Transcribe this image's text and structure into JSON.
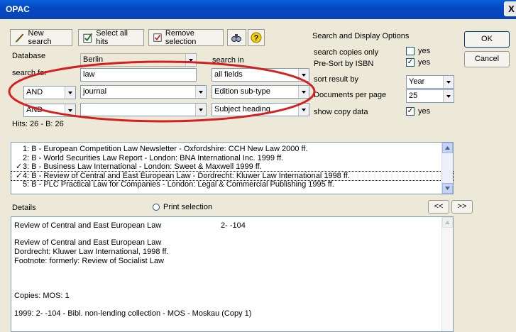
{
  "window": {
    "title": "OPAC",
    "close_glyph": "X"
  },
  "toolbar": {
    "new_search": "New search",
    "select_all": "Select all hits",
    "remove_selection": "Remove selection"
  },
  "search": {
    "database_label": "Database",
    "database_value": "Berlin",
    "search_in_label": "search in",
    "search_for_label": "search for",
    "row1": {
      "term": "law",
      "field": "all fields"
    },
    "row2": {
      "operator": "AND",
      "term": "journal",
      "field": "Edition sub-type"
    },
    "row3": {
      "operator": "AND",
      "term": "",
      "field": "Subject heading"
    },
    "hits": "Hits: 26 - B: 26"
  },
  "options": {
    "heading": "Search and Display Options",
    "copies_only_label": "search copies only",
    "copies_only_checked": false,
    "presort_label": "Pre-Sort by ISBN",
    "presort_checked": true,
    "sort_label": "sort result by",
    "sort_value": "Year",
    "docs_label": "Documents per page",
    "docs_value": "25",
    "copy_data_label": "show copy data",
    "copy_data_checked": true,
    "yes": "yes",
    "check_glyph": "✓"
  },
  "buttons": {
    "ok": "OK",
    "cancel": "Cancel",
    "prev": "<<",
    "next": ">>"
  },
  "results": [
    {
      "text": "1: B - European Competition Law Newsletter - Oxfordshire: CCH New Law 2000 ff.",
      "checked": false
    },
    {
      "text": "2: B - World Securities Law Report - London: BNA International Inc. 1999 ff.",
      "checked": false
    },
    {
      "text": "3: B - Business Law International - London: Sweet & Maxwell 1999 ff.",
      "checked": true
    },
    {
      "text": "4: B - Review of Central and East European Law - Dordrecht: Kluwer Law International 1998 ff.",
      "checked": true
    },
    {
      "text": "5: B - PLC Practical Law for Companies - London: Legal & Commercial Publishing 1995 ff.",
      "checked": false
    }
  ],
  "details": {
    "label": "Details",
    "print_label": "Print selection",
    "title_line": "Review of Central and East European Law",
    "signature": "2- -104",
    "lines": [
      "Review of Central and East European Law",
      "Dordrecht: Kluwer Law International, 1998 ff.",
      "Footnote: formerly: Review of Socialist Law"
    ],
    "copies": "Copies:  MOS: 1",
    "holding": "1999: 2- -104 - Bibl. non-lending collection - MOS - Moskau (Copy 1)"
  },
  "colors": {
    "annotation_ellipse": "#d42020",
    "title_bar": "#0a5fd8"
  }
}
